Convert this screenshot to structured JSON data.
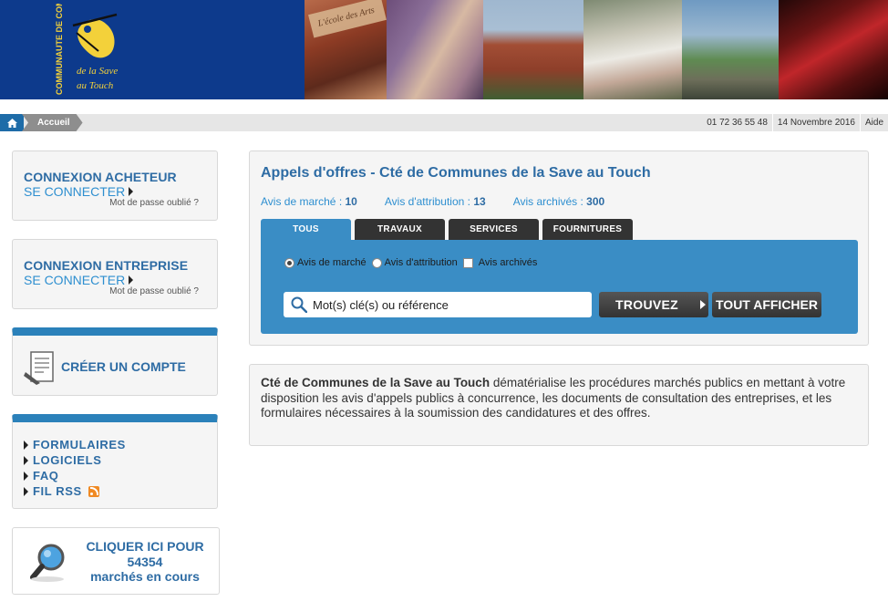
{
  "header": {
    "logo_vertical_text": "COMMUNAUTE DE COMMUNES",
    "logo_sub1": "de la Save",
    "logo_sub2": "au Touch",
    "photo1_sign": "L'école des Arts"
  },
  "breadcrumb": {
    "home_icon": "home-icon",
    "current": "Accueil",
    "phone": "01 72 36 55 48",
    "date": "14 Novembre 2016",
    "help": "Aide"
  },
  "sidebar": {
    "buyer": {
      "title": "CONNEXION ACHETEUR",
      "link": "SE CONNECTER",
      "forgot": "Mot de passe oublié ?"
    },
    "company": {
      "title": "CONNEXION ENTREPRISE",
      "link": "SE CONNECTER",
      "forgot": "Mot de passe oublié ?"
    },
    "create_account": "CRÉER UN COMPTE",
    "links": [
      "FORMULAIRES",
      "LOGICIELS",
      "FAQ",
      "FIL RSS"
    ],
    "search_promo": {
      "line1": "CLIQUER ICI POUR",
      "count": "54354",
      "line3": "marchés en cours"
    }
  },
  "main": {
    "title": "Appels d'offres - Cté de Communes de la Save au Touch",
    "counts": [
      {
        "label": "Avis de marché :",
        "value": "10"
      },
      {
        "label": "Avis d'attribution :",
        "value": "13"
      },
      {
        "label": "Avis archivés :",
        "value": "300"
      }
    ],
    "tabs": [
      "TOUS",
      "TRAVAUX",
      "SERVICES",
      "FOURNITURES"
    ],
    "active_tab": "TOUS",
    "options": {
      "radio1": "Avis de marché",
      "radio2": "Avis d'attribution",
      "checkbox": "Avis archivés",
      "selected": "Avis de marché"
    },
    "search": {
      "placeholder": "Mot(s) clé(s) ou référence",
      "value": ""
    },
    "find_button": "TROUVEZ",
    "show_all_button": "TOUT AFFICHER"
  },
  "description": {
    "org": "Cté de Communes de la Save au Touch",
    "text": " dématérialise les procédures marchés publics en mettant à votre disposition les avis d'appels publics à concurrence, les documents de consultation des entreprises, et les formulaires nécessaires à la soumission des candidatures et des offres."
  },
  "colors": {
    "brand_blue": "#0d3a8c",
    "accent_blue": "#2e6ca4",
    "panel_blue": "#3a8dc5",
    "logo_yellow": "#f3d13a"
  }
}
